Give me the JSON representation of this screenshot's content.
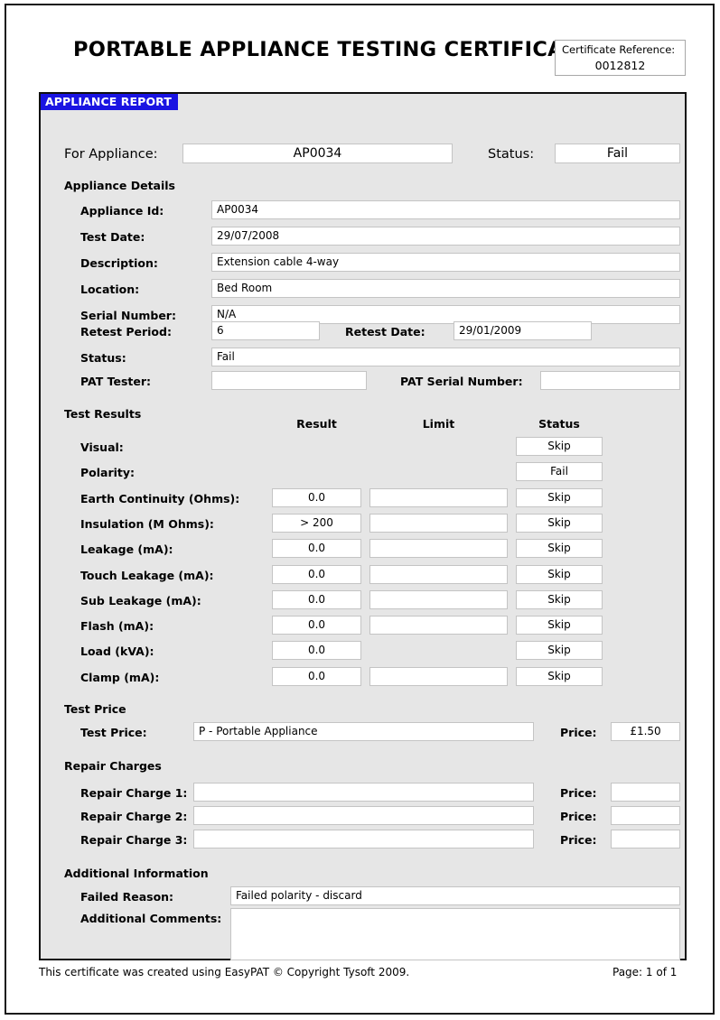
{
  "document": {
    "title": "PORTABLE APPLIANCE TESTING CERTIFICATE",
    "certificate_reference_label": "Certificate Reference:",
    "certificate_reference_value": "0012812"
  },
  "panel": {
    "tab_title": "APPLIANCE REPORT",
    "summary": {
      "for_appliance_label": "For Appliance:",
      "for_appliance_value": "AP0034",
      "status_label": "Status:",
      "status_value": "Fail"
    },
    "appliance_details": {
      "heading": "Appliance Details",
      "rows": [
        {
          "label": "Appliance Id:",
          "value": "AP0034"
        },
        {
          "label": "Test Date:",
          "value": "29/07/2008"
        },
        {
          "label": "Description:",
          "value": "Extension cable 4-way"
        },
        {
          "label": "Location:",
          "value": "Bed Room"
        },
        {
          "label": "Serial Number:",
          "value": "N/A"
        }
      ],
      "retest_period_label": "Retest Period:",
      "retest_period_value": "6",
      "retest_date_label": "Retest Date:",
      "retest_date_value": "29/01/2009",
      "status_label": "Status:",
      "status_value": "Fail",
      "pat_tester_label": "PAT Tester:",
      "pat_tester_value": "",
      "pat_serial_label": "PAT Serial Number:",
      "pat_serial_value": ""
    },
    "test_results": {
      "heading": "Test Results",
      "columns": [
        "Result",
        "Limit",
        "Status"
      ],
      "rows": [
        {
          "label": "Visual:",
          "result": "",
          "limit": "",
          "status": "Skip",
          "has_result": false,
          "has_limit": false
        },
        {
          "label": "Polarity:",
          "result": "",
          "limit": "",
          "status": "Fail",
          "has_result": false,
          "has_limit": false
        },
        {
          "label": "Earth Continuity (Ohms):",
          "result": "0.0",
          "limit": "",
          "status": "Skip",
          "has_result": true,
          "has_limit": true
        },
        {
          "label": "Insulation (M Ohms):",
          "result": "> 200",
          "limit": "",
          "status": "Skip",
          "has_result": true,
          "has_limit": true
        },
        {
          "label": "Leakage (mA):",
          "result": "0.0",
          "limit": "",
          "status": "Skip",
          "has_result": true,
          "has_limit": true
        },
        {
          "label": "Touch Leakage (mA):",
          "result": "0.0",
          "limit": "",
          "status": "Skip",
          "has_result": true,
          "has_limit": true
        },
        {
          "label": "Sub Leakage (mA):",
          "result": "0.0",
          "limit": "",
          "status": "Skip",
          "has_result": true,
          "has_limit": true
        },
        {
          "label": "Flash (mA):",
          "result": "0.0",
          "limit": "",
          "status": "Skip",
          "has_result": true,
          "has_limit": true
        },
        {
          "label": "Load (kVA):",
          "result": "0.0",
          "limit": "",
          "status": "Skip",
          "has_result": true,
          "has_limit": false
        },
        {
          "label": "Clamp (mA):",
          "result": "0.0",
          "limit": "",
          "status": "Skip",
          "has_result": true,
          "has_limit": true
        }
      ]
    },
    "test_price": {
      "heading": "Test Price",
      "label": "Test Price:",
      "value": "P - Portable Appliance",
      "price_label": "Price:",
      "price_value": "£1.50"
    },
    "repair_charges": {
      "heading": "Repair Charges",
      "price_label": "Price:",
      "rows": [
        {
          "label": "Repair Charge 1:",
          "value": "",
          "price": ""
        },
        {
          "label": "Repair Charge 2:",
          "value": "",
          "price": ""
        },
        {
          "label": "Repair Charge 3:",
          "value": "",
          "price": ""
        }
      ]
    },
    "additional_information": {
      "heading": "Additional Information",
      "failed_reason_label": "Failed Reason:",
      "failed_reason_value": "Failed polarity - discard",
      "comments_label": "Additional Comments:",
      "comments_value": ""
    }
  },
  "footer": {
    "left": "This certificate was created using EasyPAT © Copyright Tysoft 2009.",
    "right": "Page: 1 of 1"
  },
  "colors": {
    "accent": "#1a14e2",
    "panel_bg": "#e6e6e6",
    "field_bg": "#ffffff",
    "border": "#101010"
  }
}
